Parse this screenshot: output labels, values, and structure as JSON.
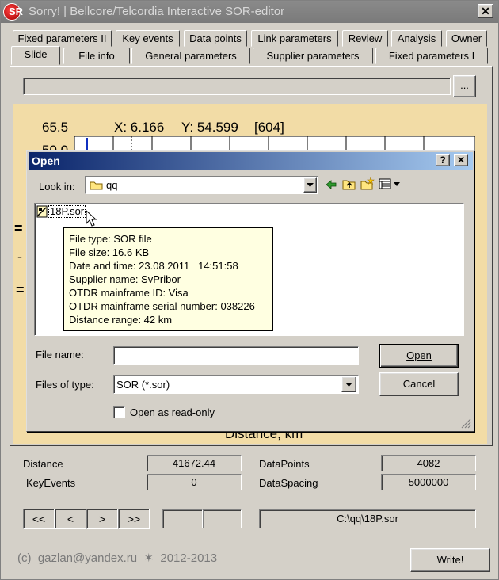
{
  "window": {
    "title": "Sorry!  |  Bellcore/Telcordia Interactive SOR-editor",
    "icon_letters": "SR",
    "close_glyph": "✕"
  },
  "tabs": {
    "row1": [
      "Fixed parameters II",
      "Key events",
      "Data points",
      "Link parameters",
      "Review",
      "Analysis",
      "Owner"
    ],
    "row2": [
      "Slide",
      "File info",
      "General parameters",
      "Supplier parameters",
      "Fixed parameters I"
    ]
  },
  "path_bar": {
    "value": "",
    "browse_label": "..."
  },
  "plot": {
    "y_top": "65.5",
    "cursor_x_label": "X: 6.166",
    "cursor_y_label": "Y: 54.599",
    "index_label": "[604]",
    "y_second_partial": "50.0",
    "xlabel": "Distance, km"
  },
  "dialog": {
    "title": "Open",
    "help_glyph": "?",
    "close_glyph": "✕",
    "look_in_label": "Look in:",
    "look_in_value": "qq",
    "files": [
      {
        "name": "18P.sor"
      }
    ],
    "tooltip_lines": [
      "File type: SOR file",
      "File size: 16.6 KB",
      "Date and time: 23.08.2011   14:51:58",
      "Supplier name: SvPribor",
      "OTDR mainframe ID: Visa",
      "OTDR mainframe serial number: 038226",
      "Distance range: 42 km"
    ],
    "file_name_label": "File name:",
    "file_name_value": "",
    "files_of_type_label": "Files of type:",
    "files_of_type_value": "SOR (*.sor)",
    "open_button": "Open",
    "cancel_button": "Cancel",
    "readonly_label": "Open as read-only",
    "readonly_checked": false
  },
  "stats": {
    "distance_label": "Distance",
    "distance_value": "41672.44",
    "keyevents_label": "KeyEvents",
    "keyevents_value": "0",
    "datapoints_label": "DataPoints",
    "datapoints_value": "4082",
    "dataspacing_label": "DataSpacing",
    "dataspacing_value": "5000000"
  },
  "navigation": {
    "first": "<<",
    "prev": "<",
    "next": ">",
    "last": ">>",
    "field1": "",
    "field2": "",
    "filepath": "C:\\qq\\18P.sor"
  },
  "footer": {
    "copyright": "(c)  gazlan@yandex.ru  ✶  2012-2013",
    "write_button": "Write!"
  },
  "colors": {
    "plot_bg": "#f2dca6",
    "dialog_title_start": "#0a246a",
    "dialog_title_end": "#a6caf0",
    "tooltip_bg": "#ffffe1"
  }
}
